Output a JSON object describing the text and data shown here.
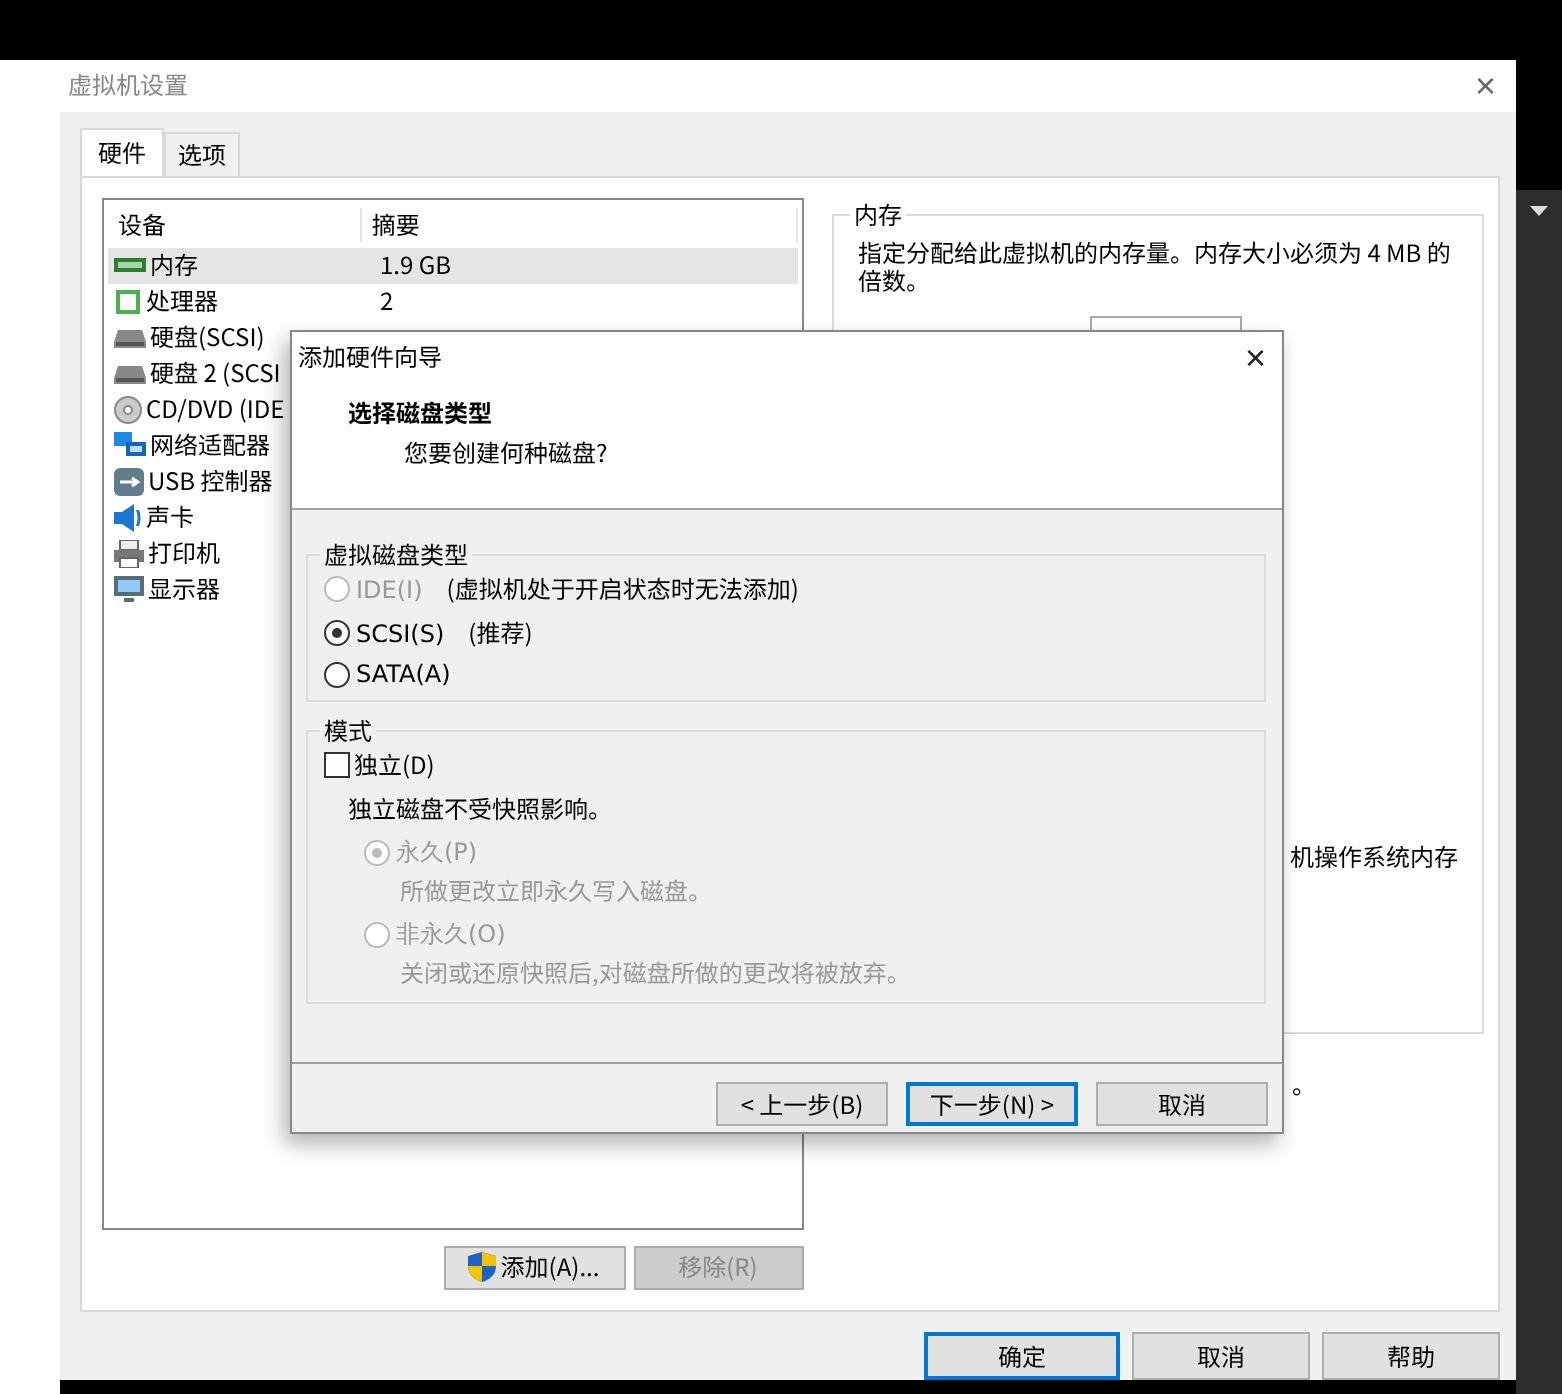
{
  "window": {
    "title": "虚拟机设置",
    "close": "×"
  },
  "tabs": [
    {
      "label": "硬件",
      "selected": true
    },
    {
      "label": "选项",
      "selected": false
    }
  ],
  "devices": {
    "columns": [
      "设备",
      "摘要"
    ],
    "rows": [
      {
        "kind": "memory",
        "name": "内存",
        "summary": "1.9 GB",
        "selected": true
      },
      {
        "kind": "processor",
        "name": "处理器",
        "summary": "2",
        "selected": false
      },
      {
        "kind": "disk",
        "name": "硬盘(SCSI)",
        "selected": false
      },
      {
        "kind": "disk",
        "name": "硬盘 2 (SCSI",
        "selected": false
      },
      {
        "kind": "cdrom",
        "name": "CD/DVD (IDE",
        "selected": false
      },
      {
        "kind": "network",
        "name": "网络适配器",
        "selected": false
      },
      {
        "kind": "usb",
        "name": "USB 控制器",
        "selected": false
      },
      {
        "kind": "sound",
        "name": "声卡",
        "selected": false
      },
      {
        "kind": "printer",
        "name": "打印机",
        "selected": false
      },
      {
        "kind": "display",
        "name": "显示器",
        "selected": false
      }
    ]
  },
  "device_buttons": [
    {
      "kind": "shield",
      "label": "添加(A)...",
      "disabled": false
    },
    {
      "label": "移除(R)",
      "disabled": true
    }
  ],
  "memory_panel": {
    "title": "内存",
    "description": "指定分配给此虚拟机的内存量。内存大小必须为 4 MB 的倍数。",
    "fragment_1": "机操作系统内存",
    "fragment_2": "。"
  },
  "footer_buttons": [
    {
      "label": "确定",
      "default": true
    },
    {
      "label": "取消",
      "default": false
    },
    {
      "label": "帮助",
      "default": false
    }
  ],
  "wizard": {
    "title": "添加硬件向导",
    "close": "×",
    "heading": "选择磁盘类型",
    "subheading": "您要创建何种磁盘?",
    "disk_type": {
      "title": "虚拟磁盘类型",
      "options": [
        {
          "label": "IDE(I)",
          "note": "(虚拟机处于开启状态时无法添加)",
          "selected": false,
          "disabled": true
        },
        {
          "label": "SCSI(S)",
          "note": "(推荐)",
          "selected": true,
          "disabled": false
        },
        {
          "label": "SATA(A)",
          "selected": false,
          "disabled": false
        }
      ]
    },
    "mode": {
      "title": "模式",
      "independent": {
        "label": "独立(D)",
        "checked": false
      },
      "description": "独立磁盘不受快照影响。",
      "options": [
        {
          "label": "永久(P)",
          "hint": "所做更改立即永久写入磁盘。",
          "selected": true,
          "disabled": true
        },
        {
          "label": "非永久(O)",
          "hint": "关闭或还原快照后,对磁盘所做的更改将被放弃。",
          "selected": false,
          "disabled": true
        }
      ]
    },
    "buttons": [
      {
        "label": "< 上一步(B)",
        "default": false
      },
      {
        "label": "下一步(N) >",
        "default": true
      },
      {
        "label": "取消",
        "default": false
      }
    ]
  }
}
